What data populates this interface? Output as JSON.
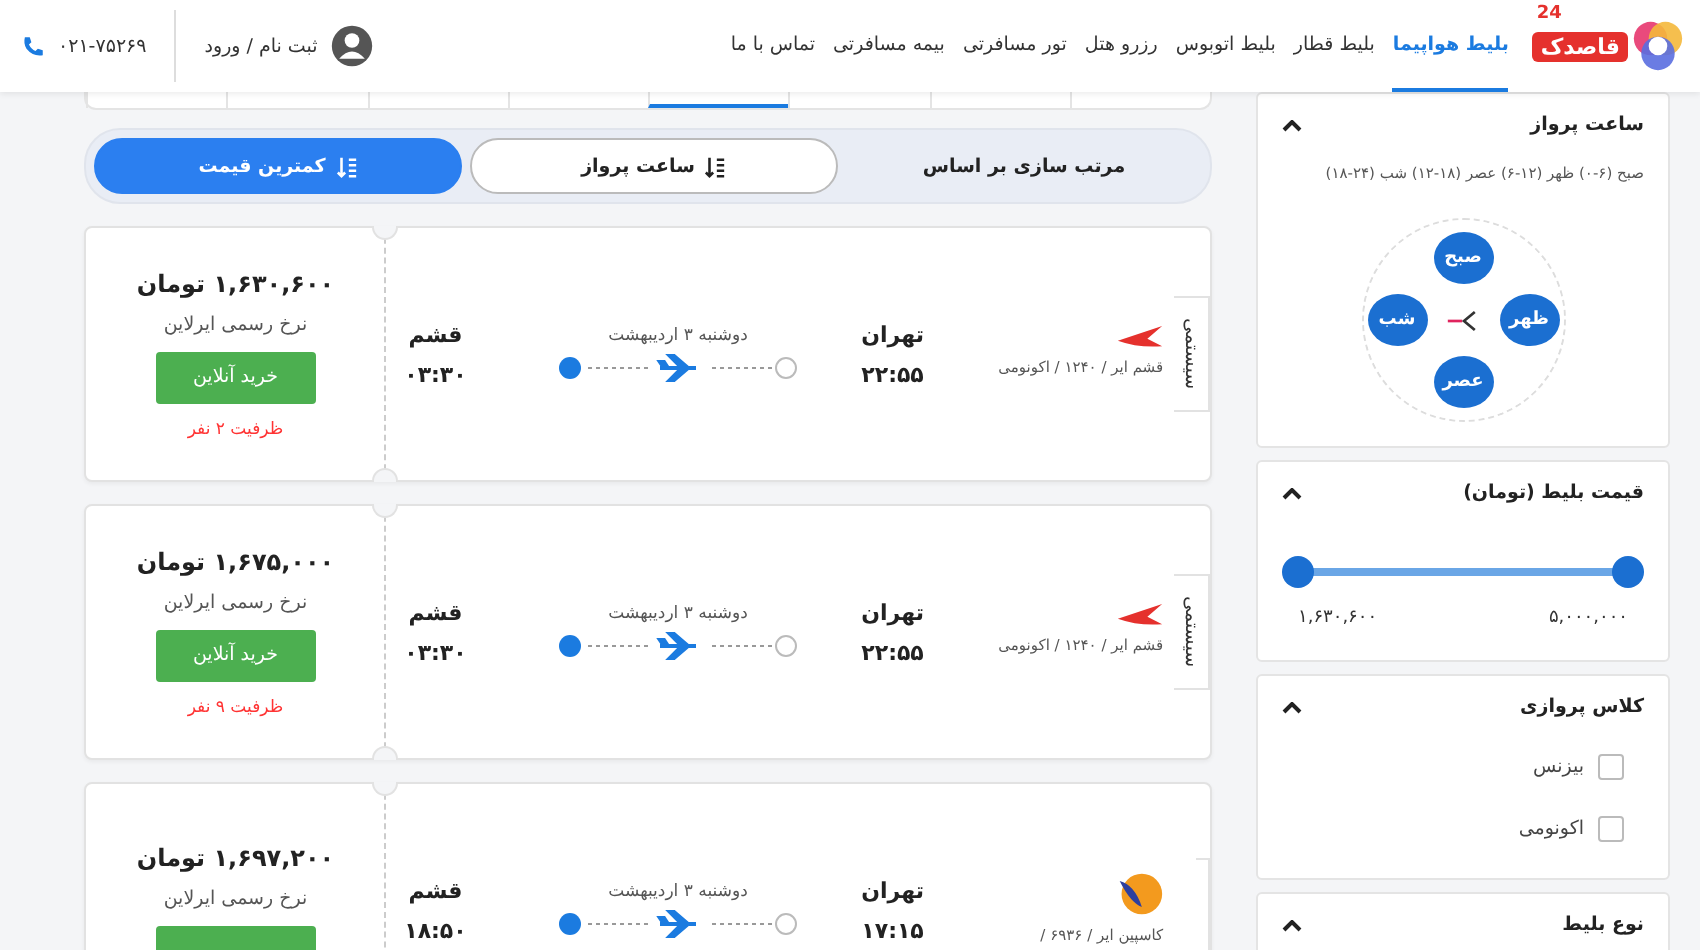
{
  "header": {
    "logo": {
      "text": "قاصدک",
      "badge": "24"
    },
    "nav": [
      {
        "label": "بلیط هواپیما",
        "selected": true
      },
      {
        "label": "بلیط قطار",
        "selected": false
      },
      {
        "label": "بلیط اتوبوس",
        "selected": false
      },
      {
        "label": "رزرو هتل",
        "selected": false
      },
      {
        "label": "تور مسافرتی",
        "selected": false
      },
      {
        "label": "بیمه مسافرتی",
        "selected": false
      },
      {
        "label": "تماس با ما",
        "selected": false
      }
    ],
    "login": "ثبت نام / ورود",
    "phone": "۰۲۱-۷۵۲۶۹"
  },
  "date_tabs": [
    {
      "selected": false
    },
    {
      "selected": false
    },
    {
      "selected": false
    },
    {
      "selected": true
    },
    {
      "selected": false
    },
    {
      "selected": false
    },
    {
      "selected": false
    },
    {
      "selected": false
    }
  ],
  "sort_bar": {
    "label": "مرتب سازی بر اساس",
    "options": [
      {
        "label": "ساعت پرواز",
        "selected": false
      },
      {
        "label": "کمترین قیمت",
        "selected": true
      }
    ]
  },
  "flights": [
    {
      "type_tab": "سیستمی",
      "logo": {
        "kind": "wing"
      },
      "airline_info": "قشم ایر / ۱۲۴۰ / اکونومی",
      "from_city": "تهران",
      "from_time": "۲۲:۵۵",
      "date": "دوشنبه ۳ اردیبهشت",
      "to_city": "قشم",
      "to_time": "۰۳:۳۰",
      "price": "۱,۶۳۰,۶۰۰ تومان",
      "rate_note": "نرخ رسمی ایرلاین",
      "buy_button": "خرید آنلاین",
      "capacity": "ظرفیت ۲ نفر"
    },
    {
      "type_tab": "سیستمی",
      "logo": {
        "kind": "wing"
      },
      "airline_info": "قشم ایر / ۱۲۴۰ / اکونومی",
      "from_city": "تهران",
      "from_time": "۲۲:۵۵",
      "date": "دوشنبه ۳ اردیبهشت",
      "to_city": "قشم",
      "to_time": "۰۳:۳۰",
      "price": "۱,۶۷۵,۰۰۰ تومان",
      "rate_note": "نرخ رسمی ایرلاین",
      "buy_button": "خرید آنلاین",
      "capacity": "ظرفیت ۹ نفر"
    },
    {
      "logo": {
        "kind": "circle"
      },
      "airline_info": "کاسپین ایر / ۶۹۳۶ /",
      "from_city": "تهران",
      "from_time": "۱۷:۱۵",
      "date": "دوشنبه ۳ اردیبهشت",
      "to_city": "قشم",
      "to_time": "۱۸:۵۰",
      "price": "۱,۶۹۷,۲۰۰ تومان",
      "rate_note": "نرخ رسمی ایرلاین"
    }
  ],
  "filters": {
    "time": {
      "title": "ساعت پرواز",
      "legend": "صبح (۶-۰) ظهر (۱۲-۶) عصر (۱۸-۱۲) شب (۲۴-۱۸)",
      "slots": {
        "top": "صبح",
        "right": "ظهر",
        "bottom": "عصر",
        "left": "شب"
      }
    },
    "price": {
      "title": "قیمت بلیط (تومان)",
      "thumbs": [
        {
          "level": 0
        },
        {
          "level": 1
        }
      ],
      "min": "۱,۶۳۰,۶۰۰",
      "max": "۵,۰۰۰,۰۰۰"
    },
    "class": {
      "title": "کلاس پروازی",
      "options": [
        {
          "label": "بیزنس",
          "checked": false
        },
        {
          "label": "اکونومی",
          "checked": false
        }
      ]
    },
    "ticket_type": {
      "title": "نوع بلیط"
    }
  }
}
